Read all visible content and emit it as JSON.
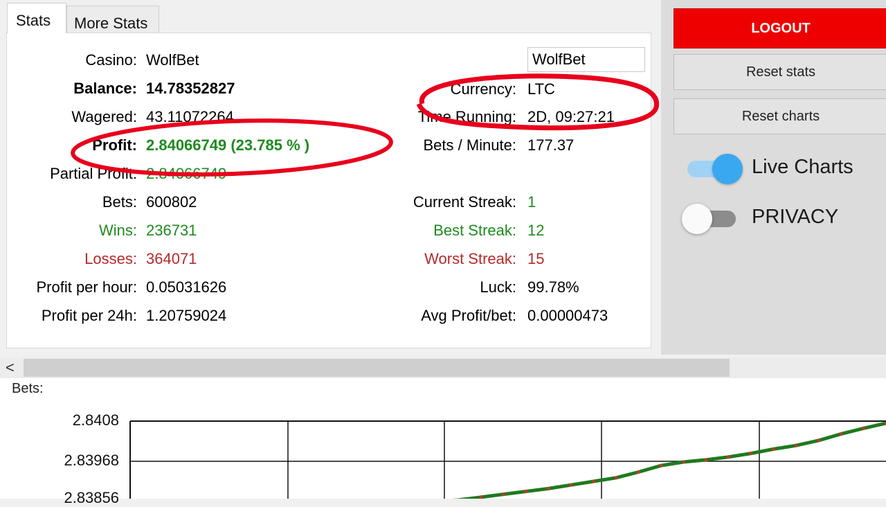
{
  "tabs": {
    "stats": "Stats",
    "more_stats": "More Stats"
  },
  "casino_select": "WolfBet",
  "stats_left": [
    {
      "label": "Casino:",
      "value": "WolfBet",
      "style": "normal"
    },
    {
      "label": "Balance:",
      "value": "14.78352827",
      "style": "bold"
    },
    {
      "label": "Wagered:",
      "value": "43.11072264",
      "style": "normal"
    },
    {
      "label": "Profit:",
      "value": "2.84066749 (23.785 % )",
      "style": "profit"
    },
    {
      "label": "Partial Profit:",
      "value": "2.84066749",
      "style": "partial"
    },
    {
      "label": "Bets:",
      "value": "600802",
      "style": "normal"
    },
    {
      "label": "Wins:",
      "value": "236731",
      "style": "green"
    },
    {
      "label": "Losses:",
      "value": "364071",
      "style": "red"
    },
    {
      "label": "Profit per hour:",
      "value": "0.05031626",
      "style": "normal"
    },
    {
      "label": "Profit per 24h:",
      "value": "1.20759024",
      "style": "normal"
    }
  ],
  "stats_right": [
    {
      "label": "Currency:",
      "value": "LTC",
      "style": "normal"
    },
    {
      "label": "Time Running:",
      "value": "2D, 09:27:21",
      "style": "normal"
    },
    {
      "label": "Bets / Minute:",
      "value": "177.37",
      "style": "normal"
    },
    {
      "label": "Current Streak:",
      "value": "1",
      "style": "cur"
    },
    {
      "label": "Best Streak:",
      "value": "12",
      "style": "green"
    },
    {
      "label": "Worst Streak:",
      "value": "15",
      "style": "red"
    },
    {
      "label": "Luck:",
      "value": "99.78%",
      "style": "normal"
    },
    {
      "label": "Avg Profit/bet:",
      "value": "0.00000473",
      "style": "normal"
    }
  ],
  "buttons": {
    "logout": "LOGOUT",
    "reset_stats": "Reset stats",
    "reset_charts": "Reset charts"
  },
  "toggles": {
    "live_charts": {
      "label": "Live Charts",
      "on": true
    },
    "privacy": {
      "label": "PRIVACY",
      "on": false
    }
  },
  "scrollbar": {
    "left_arrow": "<"
  },
  "chart": {
    "section_label": "Bets:"
  },
  "chart_data": {
    "type": "line",
    "title": "",
    "xlabel": "",
    "ylabel": "",
    "y_ticks": [
      "2.8408",
      "2.83968",
      "2.83856"
    ],
    "ylim": [
      2.8383,
      2.8411
    ],
    "grid": true,
    "series": [
      {
        "color": "#1e7a1e",
        "x": [
          0,
          1,
          2,
          3,
          4,
          5,
          6,
          7,
          8,
          9,
          10,
          11,
          12,
          13,
          14,
          15,
          16,
          17,
          18,
          19,
          20
        ],
        "values": [
          2.83856,
          2.8386,
          2.83868,
          2.83876,
          2.83884,
          2.83892,
          2.83902,
          2.83912,
          2.83922,
          2.83938,
          2.83956,
          2.83966,
          2.83972,
          2.8398,
          2.8399,
          2.84002,
          2.84012,
          2.84026,
          2.84044,
          2.8406,
          2.84074
        ]
      }
    ]
  },
  "colors": {
    "logout_bg": "#ee0000",
    "green": "#1f8a1f",
    "red": "#b52a2a",
    "toggle_on": "#3aa8f0",
    "annotation": "#e8001c"
  }
}
